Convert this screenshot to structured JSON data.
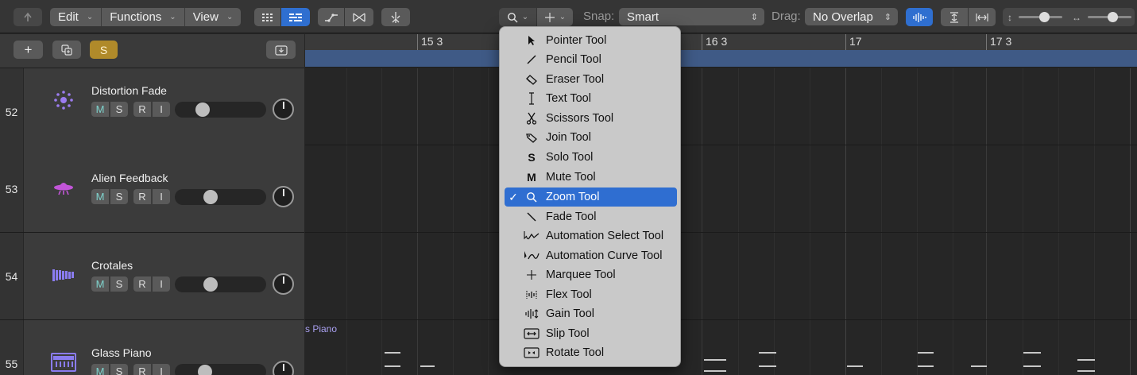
{
  "toolbar": {
    "back_icon": "back-arrow-icon",
    "edit_label": "Edit",
    "functions_label": "Functions",
    "view_label": "View",
    "snap_label": "Snap:",
    "snap_value": "Smart",
    "drag_label": "Drag:",
    "drag_value": "No Overlap",
    "accent": "#2f6fd0"
  },
  "tracks_header": {
    "solo_label": "S"
  },
  "tracks": [
    {
      "number": "52",
      "name": "Distortion Fade",
      "icon": "radiating-dots-icon",
      "mute": "M",
      "solo": "S",
      "record": "R",
      "input": "I",
      "volume": 0.27
    },
    {
      "number": "53",
      "name": "Alien Feedback",
      "icon": "ufo-icon",
      "mute": "M",
      "solo": "S",
      "record": "R",
      "input": "I",
      "volume": 0.37
    },
    {
      "number": "54",
      "name": "Crotales",
      "icon": "crotales-icon",
      "mute": "M",
      "solo": "S",
      "record": "R",
      "input": "I",
      "volume": 0.37
    },
    {
      "number": "55",
      "name": "Glass Piano",
      "icon": "piano-icon",
      "mute": "M",
      "solo": "S",
      "record": "R",
      "input": "I",
      "volume": 0.3
    }
  ],
  "ruler": {
    "marks": [
      "15 3",
      "16 3",
      "17",
      "17 3"
    ]
  },
  "region": {
    "label": "s Piano"
  },
  "tool_menu": {
    "items": [
      {
        "label": "Pointer Tool",
        "icon": "pointer-icon"
      },
      {
        "label": "Pencil Tool",
        "icon": "pencil-icon"
      },
      {
        "label": "Eraser Tool",
        "icon": "eraser-icon"
      },
      {
        "label": "Text Tool",
        "icon": "text-cursor-icon"
      },
      {
        "label": "Scissors Tool",
        "icon": "scissors-icon"
      },
      {
        "label": "Join Tool",
        "icon": "join-icon"
      },
      {
        "label": "Solo Tool",
        "icon": "solo-letter-icon",
        "glyph": "S"
      },
      {
        "label": "Mute Tool",
        "icon": "mute-letter-icon",
        "glyph": "M"
      },
      {
        "label": "Zoom Tool",
        "icon": "magnifier-icon",
        "selected": true,
        "check": "✓"
      },
      {
        "label": "Fade Tool",
        "icon": "fade-icon"
      },
      {
        "label": "Automation Select Tool",
        "icon": "automation-select-icon"
      },
      {
        "label": "Automation Curve Tool",
        "icon": "automation-curve-icon"
      },
      {
        "label": "Marquee Tool",
        "icon": "crosshair-icon"
      },
      {
        "label": "Flex Tool",
        "icon": "flex-icon"
      },
      {
        "label": "Gain Tool",
        "icon": "gain-icon"
      },
      {
        "label": "Slip Tool",
        "icon": "slip-icon"
      },
      {
        "label": "Rotate Tool",
        "icon": "rotate-icon"
      }
    ]
  }
}
